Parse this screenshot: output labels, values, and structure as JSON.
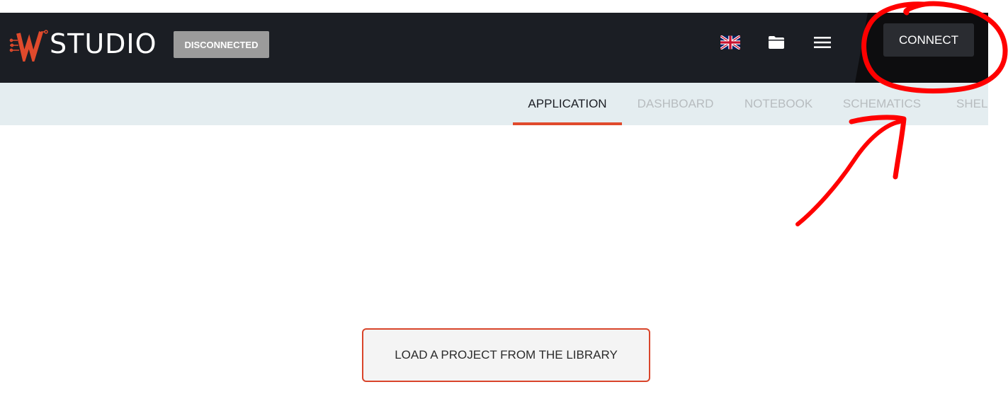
{
  "header": {
    "brand_text": "STUDIO",
    "status_label": "DISCONNECTED",
    "connect_label": "CONNECT",
    "icons": [
      "uk-flag-icon",
      "folder-icon",
      "menu-icon"
    ]
  },
  "tabs": [
    {
      "label": "APPLICATION",
      "active": true
    },
    {
      "label": "DASHBOARD",
      "active": false
    },
    {
      "label": "NOTEBOOK",
      "active": false
    },
    {
      "label": "SCHEMATICS",
      "active": false
    },
    {
      "label": "SHELL",
      "active": false
    }
  ],
  "main": {
    "load_button_label": "LOAD A PROJECT FROM THE LIBRARY"
  },
  "colors": {
    "topbar": "#1b1e24",
    "accent": "#e04a2c",
    "tabbar": "#e4edf0",
    "annotation": "#ff0000"
  }
}
